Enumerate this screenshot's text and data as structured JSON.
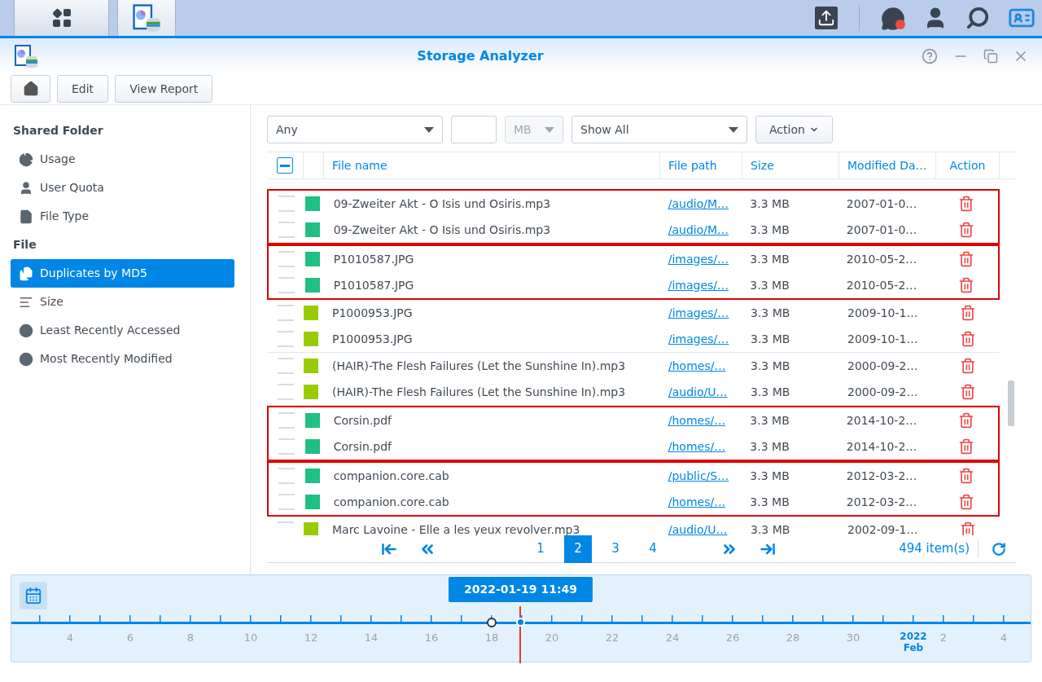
{
  "window": {
    "title": "Storage Analyzer"
  },
  "toolbar": {
    "buttons": [
      "Edit",
      "View Report"
    ]
  },
  "sidebar": {
    "sections": [
      {
        "title": "Shared Folder",
        "items": [
          {
            "label": "Usage",
            "kind": "usage",
            "selected": false
          },
          {
            "label": "User Quota",
            "kind": "quota",
            "selected": false
          },
          {
            "label": "File Type",
            "kind": "file_type",
            "selected": false
          }
        ]
      },
      {
        "title": "File",
        "items": [
          {
            "label": "Duplicates by MD5",
            "kind": "duplicates",
            "selected": true
          },
          {
            "label": "Size",
            "kind": "size",
            "selected": false
          },
          {
            "label": "Least Recently Accessed",
            "kind": "accessed",
            "selected": false
          },
          {
            "label": "Most Recently Modified",
            "kind": "modified",
            "selected": false
          }
        ]
      }
    ]
  },
  "filters": {
    "type": "Any",
    "unit": "MB",
    "show": "Show All",
    "action": "Action"
  },
  "table": {
    "select_all_partial": true,
    "columns": [
      "File name",
      "File path",
      "Size",
      "Modified Da…",
      "Action"
    ],
    "groups": [
      {
        "highlighted": true,
        "rows": [
          {
            "name": "09-Zweiter Akt - O Isis und Osiris.mp3",
            "path": "/audio/M…",
            "size": "3.3 MB",
            "date": "2007-01-0…",
            "color": "#1fbf85",
            "checked": false
          },
          {
            "name": "09-Zweiter Akt - O Isis und Osiris.mp3",
            "path": "/audio/M…",
            "size": "3.3 MB",
            "date": "2007-01-0…",
            "color": "#1fbf85",
            "checked": false
          }
        ]
      },
      {
        "highlighted": true,
        "rows": [
          {
            "name": "P1010587.JPG",
            "path": "/images/…",
            "size": "3.3 MB",
            "date": "2010-05-2…",
            "color": "#1fbf85",
            "checked": false
          },
          {
            "name": "P1010587.JPG",
            "path": "/images/…",
            "size": "3.3 MB",
            "date": "2010-05-2…",
            "color": "#1fbf85",
            "checked": false
          }
        ]
      },
      {
        "highlighted": false,
        "rows": [
          {
            "name": "P1000953.JPG",
            "path": "/images/…",
            "size": "3.3 MB",
            "date": "2009-10-1…",
            "color": "#99cc00",
            "checked": false
          },
          {
            "name": "P1000953.JPG",
            "path": "/images/…",
            "size": "3.3 MB",
            "date": "2009-10-1…",
            "color": "#99cc00",
            "checked": false
          }
        ]
      },
      {
        "highlighted": false,
        "rows": [
          {
            "name": "(HAIR)-The Flesh Failures (Let the Sunshine In).mp3",
            "path": "/homes/…",
            "size": "3.3 MB",
            "date": "2000-09-2…",
            "color": "#99cc00",
            "checked": false
          },
          {
            "name": "(HAIR)-The Flesh Failures (Let the Sunshine In).mp3",
            "path": "/audio/U…",
            "size": "3.3 MB",
            "date": "2000-09-2…",
            "color": "#99cc00",
            "checked": false
          }
        ]
      },
      {
        "highlighted": true,
        "rows": [
          {
            "name": "Corsin.pdf",
            "path": "/homes/…",
            "size": "3.3 MB",
            "date": "2014-10-2…",
            "color": "#1fbf85",
            "checked": false
          },
          {
            "name": "Corsin.pdf",
            "path": "/homes/…",
            "size": "3.3 MB",
            "date": "2014-10-2…",
            "color": "#1fbf85",
            "checked": false
          }
        ]
      },
      {
        "highlighted": true,
        "rows": [
          {
            "name": "companion.core.cab",
            "path": "/public/S…",
            "size": "3.3 MB",
            "date": "2012-03-2…",
            "color": "#1fbf85",
            "checked": false
          },
          {
            "name": "companion.core.cab",
            "path": "/homes/…",
            "size": "3.3 MB",
            "date": "2012-03-2…",
            "color": "#1fbf85",
            "checked": false
          }
        ]
      },
      {
        "highlighted": false,
        "rows": [
          {
            "name": "Marc Lavoine - Elle a les yeux revolver.mp3",
            "path": "/audio/U…",
            "size": "3.3 MB",
            "date": "2002-09-1…",
            "color": "#99cc00",
            "checked": false
          }
        ]
      }
    ]
  },
  "pagination": {
    "pages": [
      {
        "label": "1",
        "selected": false
      },
      {
        "label": "2",
        "selected": true
      },
      {
        "label": "3",
        "selected": false
      },
      {
        "label": "4",
        "selected": false
      }
    ],
    "count": "494 item(s)"
  },
  "timeline": {
    "current": "2022-01-19 11:49",
    "labels": [
      {
        "text": "4",
        "kind": "day"
      },
      {
        "text": "6",
        "kind": "day"
      },
      {
        "text": "8",
        "kind": "day"
      },
      {
        "text": "10",
        "kind": "day"
      },
      {
        "text": "12",
        "kind": "day"
      },
      {
        "text": "14",
        "kind": "day"
      },
      {
        "text": "16",
        "kind": "day"
      },
      {
        "text": "18",
        "kind": "day"
      },
      {
        "text": "20",
        "kind": "day"
      },
      {
        "text": "22",
        "kind": "day"
      },
      {
        "text": "24",
        "kind": "day"
      },
      {
        "text": "26",
        "kind": "day"
      },
      {
        "text": "28",
        "kind": "day"
      },
      {
        "text": "30",
        "kind": "day"
      },
      {
        "text": "2022",
        "sub": "Feb",
        "kind": "month"
      },
      {
        "text": "2",
        "kind": "day"
      },
      {
        "text": "4",
        "kind": "day"
      }
    ]
  }
}
